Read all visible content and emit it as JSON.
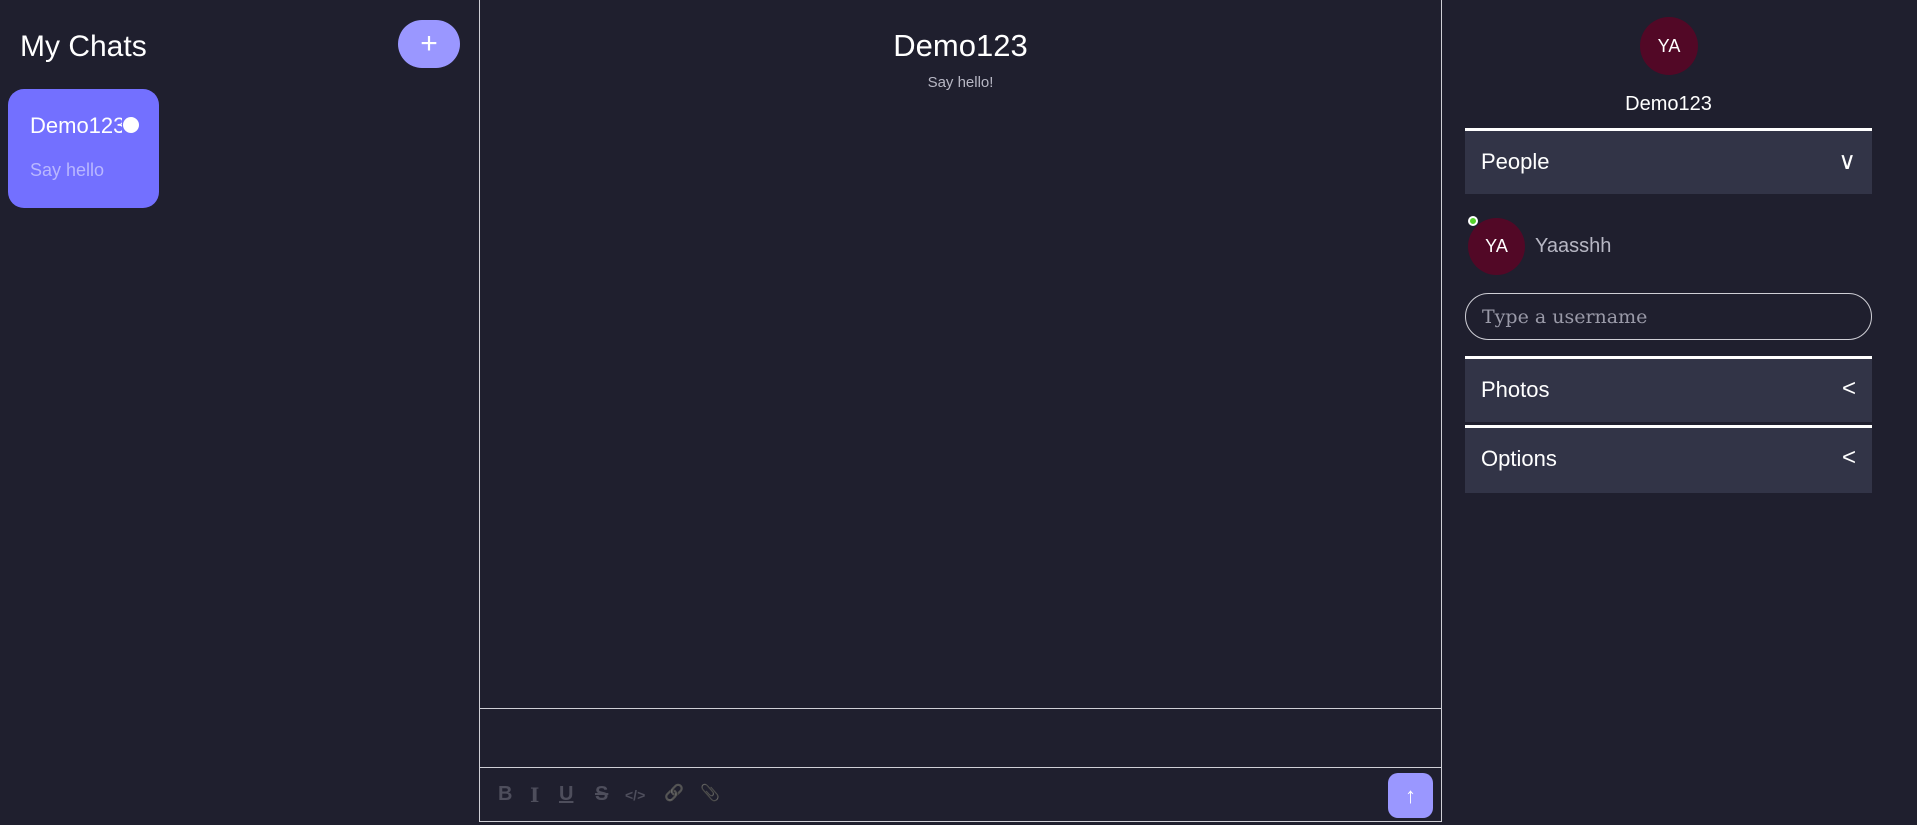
{
  "sidebar": {
    "title": "My Chats",
    "add_label": "+",
    "chats": [
      {
        "name": "Demo123",
        "preview": "Say hello",
        "active": true
      }
    ]
  },
  "chat": {
    "title": "Demo123",
    "subtitle": "Say hello!",
    "message_value": "",
    "toolbar": {
      "bold": "B",
      "italic": "I",
      "underline": "U",
      "strike": "S",
      "code": "</>",
      "link": "🔗",
      "attach": "📎"
    },
    "send_label": "↑"
  },
  "details": {
    "avatar_initials": "YA",
    "name": "Demo123",
    "sections": [
      {
        "label": "People",
        "chevron": "∨"
      },
      {
        "label": "Photos",
        "chevron": "<"
      },
      {
        "label": "Options",
        "chevron": "<"
      }
    ],
    "people": [
      {
        "initials": "YA",
        "name": "Yaasshh",
        "online": true
      }
    ],
    "username_placeholder": "Type a username"
  },
  "colors": {
    "background": "#1f1f2e",
    "accent": "#7370ff",
    "button": "#9a97ff",
    "avatar": "#520826",
    "section": "#323447",
    "online": "#55d22b"
  }
}
